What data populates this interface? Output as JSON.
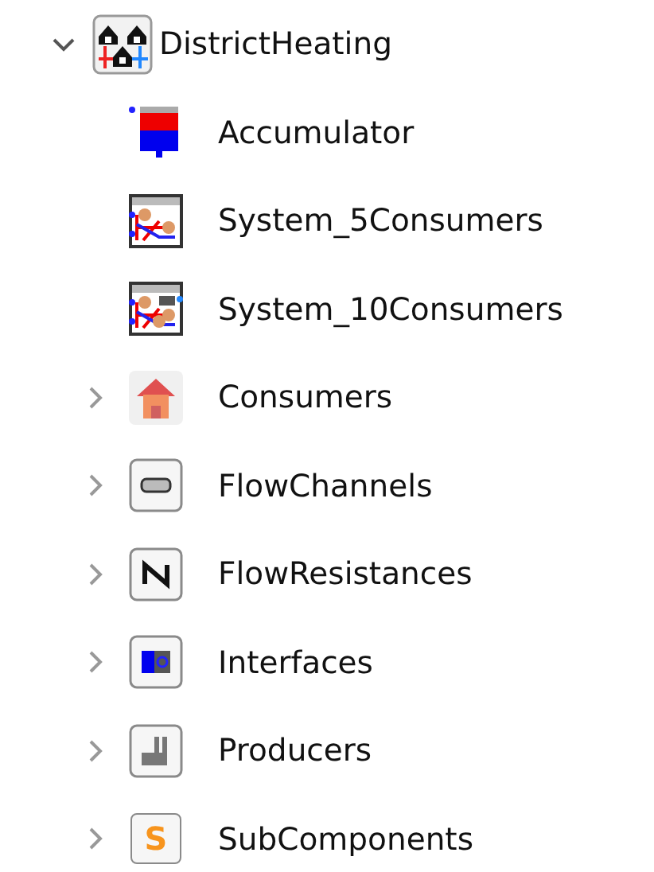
{
  "tree": [
    {
      "label": "DistrictHeating",
      "kind": "heating-package",
      "expanded": true,
      "children": [
        {
          "label": "Accumulator",
          "kind": "tank"
        },
        {
          "label": "System_5Consumers",
          "kind": "system-small"
        },
        {
          "label": "System_10Consumers",
          "kind": "system-large"
        },
        {
          "label": "Consumers",
          "kind": "house",
          "expanded": false
        },
        {
          "label": "FlowChannels",
          "kind": "pipe",
          "expanded": false
        },
        {
          "label": "FlowResistances",
          "kind": "resistance",
          "expanded": false
        },
        {
          "label": "Interfaces",
          "kind": "interface",
          "expanded": false
        },
        {
          "label": "Producers",
          "kind": "factory",
          "expanded": false
        },
        {
          "label": "SubComponents",
          "kind": "letter",
          "icon_text": "S",
          "expanded": false
        }
      ]
    }
  ]
}
